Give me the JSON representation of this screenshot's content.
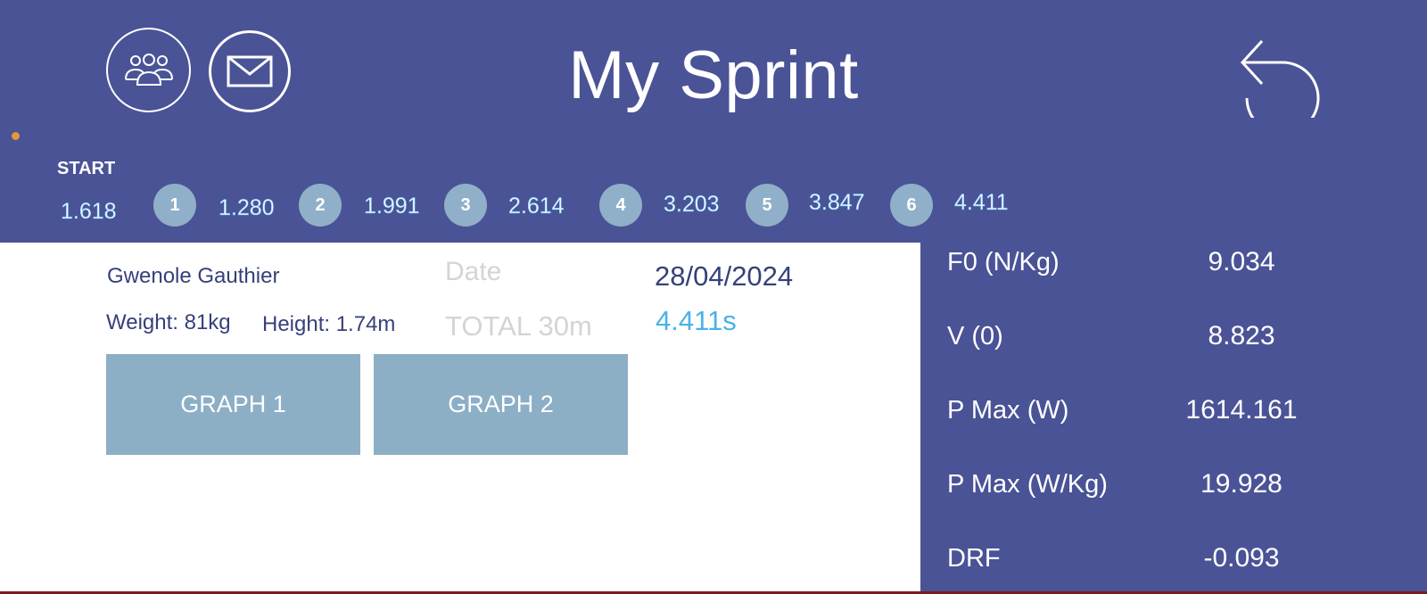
{
  "header": {
    "title": "My Sprint",
    "team_icon": "team-icon",
    "mail_icon": "mail-icon",
    "back_icon": "back-arrow-icon",
    "background": "#4a5396"
  },
  "splits": {
    "start_label": "START",
    "start_time": "1.618",
    "items": [
      {
        "badge": "1",
        "time": "1.280"
      },
      {
        "badge": "2",
        "time": "1.991"
      },
      {
        "badge": "3",
        "time": "2.614"
      },
      {
        "badge": "4",
        "time": "3.203"
      },
      {
        "badge": "5",
        "time": "3.847"
      },
      {
        "badge": "6",
        "time": "4.411"
      }
    ]
  },
  "athlete": {
    "name": "Gwenole Gauthier",
    "weight": "Weight: 81kg",
    "height": "Height: 1.74m"
  },
  "session": {
    "date_label": "Date",
    "date_value": "28/04/2024",
    "total_label": "TOTAL 30m",
    "total_value": "4.411s"
  },
  "buttons": {
    "graph1": "GRAPH 1",
    "graph2": "GRAPH 2"
  },
  "metrics": [
    {
      "label": "F0 (N/Kg)",
      "value": "9.034"
    },
    {
      "label": "V (0)",
      "value": "8.823"
    },
    {
      "label": "P Max (W)",
      "value": "1614.161"
    },
    {
      "label": "P Max (W/Kg)",
      "value": "19.928"
    },
    {
      "label": "DRF",
      "value": "-0.093"
    }
  ],
  "colors": {
    "accent_blue": "#4ab2e6",
    "badge": "#8fb0c8",
    "button": "#8cafc6",
    "indicator": "#e6953a"
  }
}
